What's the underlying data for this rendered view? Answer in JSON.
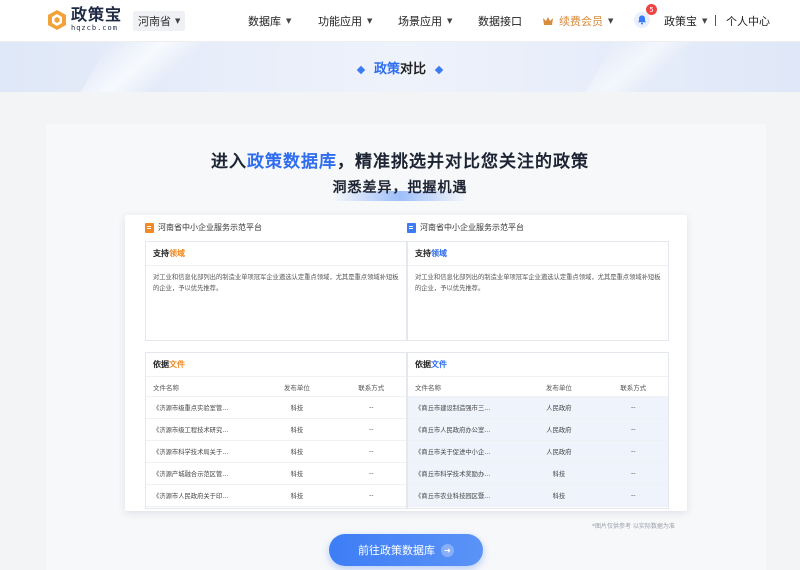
{
  "nav": {
    "logo_cn": "政策宝",
    "logo_en": "hqzcb.com",
    "region": "河南省",
    "menu": {
      "database": "数据库",
      "functions": "功能应用",
      "scenes": "场景应用",
      "api": "数据接口",
      "vip": "续费会员",
      "account": "政策宝",
      "personal": "个人中心"
    },
    "notification_count": "5"
  },
  "banner": {
    "title_hl": "政策",
    "title_rest": "对比"
  },
  "hero": {
    "line1_a": "进入",
    "line1_hl": "政策数据库",
    "line1_b": "，精准挑选并对比您关注的政策",
    "line2": "洞悉差异，把握机遇"
  },
  "compare": {
    "left": {
      "platform": "河南省中小企业服务示范平台",
      "support_label_a": "支持",
      "support_label_b": "领域",
      "support_text": "对工业和信息化部列出的制造业单项冠军企业遴选认定重点领域，尤其是重点领域补短板的企业，予以优先推荐。",
      "basis_label_a": "依据",
      "basis_label_b": "文件",
      "headers": [
        "文件名称",
        "发布单位",
        "联系方式"
      ],
      "rows": [
        [
          "《济源市级重点实验室管...",
          "科技",
          "--"
        ],
        [
          "《济源市级工程技术研究...",
          "科技",
          "--"
        ],
        [
          "《济源市科学技术局关于...",
          "科技",
          "--"
        ],
        [
          "《济源产城融合示范区管...",
          "科技",
          "--"
        ],
        [
          "《济源市人民政府关于印...",
          "科技",
          "--"
        ]
      ]
    },
    "right": {
      "platform": "河南省中小企业服务示范平台",
      "support_label_a": "支持",
      "support_label_b": "领域",
      "support_text": "对工业和信息化部列出的制造业单项冠军企业遴选认定重点领域，尤其是重点领域补短板的企业，予以优先推荐。",
      "basis_label_a": "依据",
      "basis_label_b": "文件",
      "headers": [
        "文件名称",
        "发布单位",
        "联系方式"
      ],
      "rows": [
        [
          "《商丘市建设制造强市三...",
          "人民政府",
          "--"
        ],
        [
          "《商丘市人民政府办公室...",
          "人民政府",
          "--"
        ],
        [
          "《商丘市关于促进中小企...",
          "人民政府",
          "--"
        ],
        [
          "《商丘市科学技术奖励办...",
          "科技",
          "--"
        ],
        [
          "《商丘市农业科技园区暨...",
          "科技",
          "--"
        ]
      ]
    }
  },
  "note": "*图片仅供参考 以实际数据为准",
  "cta": "前往政策数据库",
  "colors": {
    "accent": "#2f6df0",
    "orange": "#f08a24",
    "vip": "#d88b3a"
  }
}
